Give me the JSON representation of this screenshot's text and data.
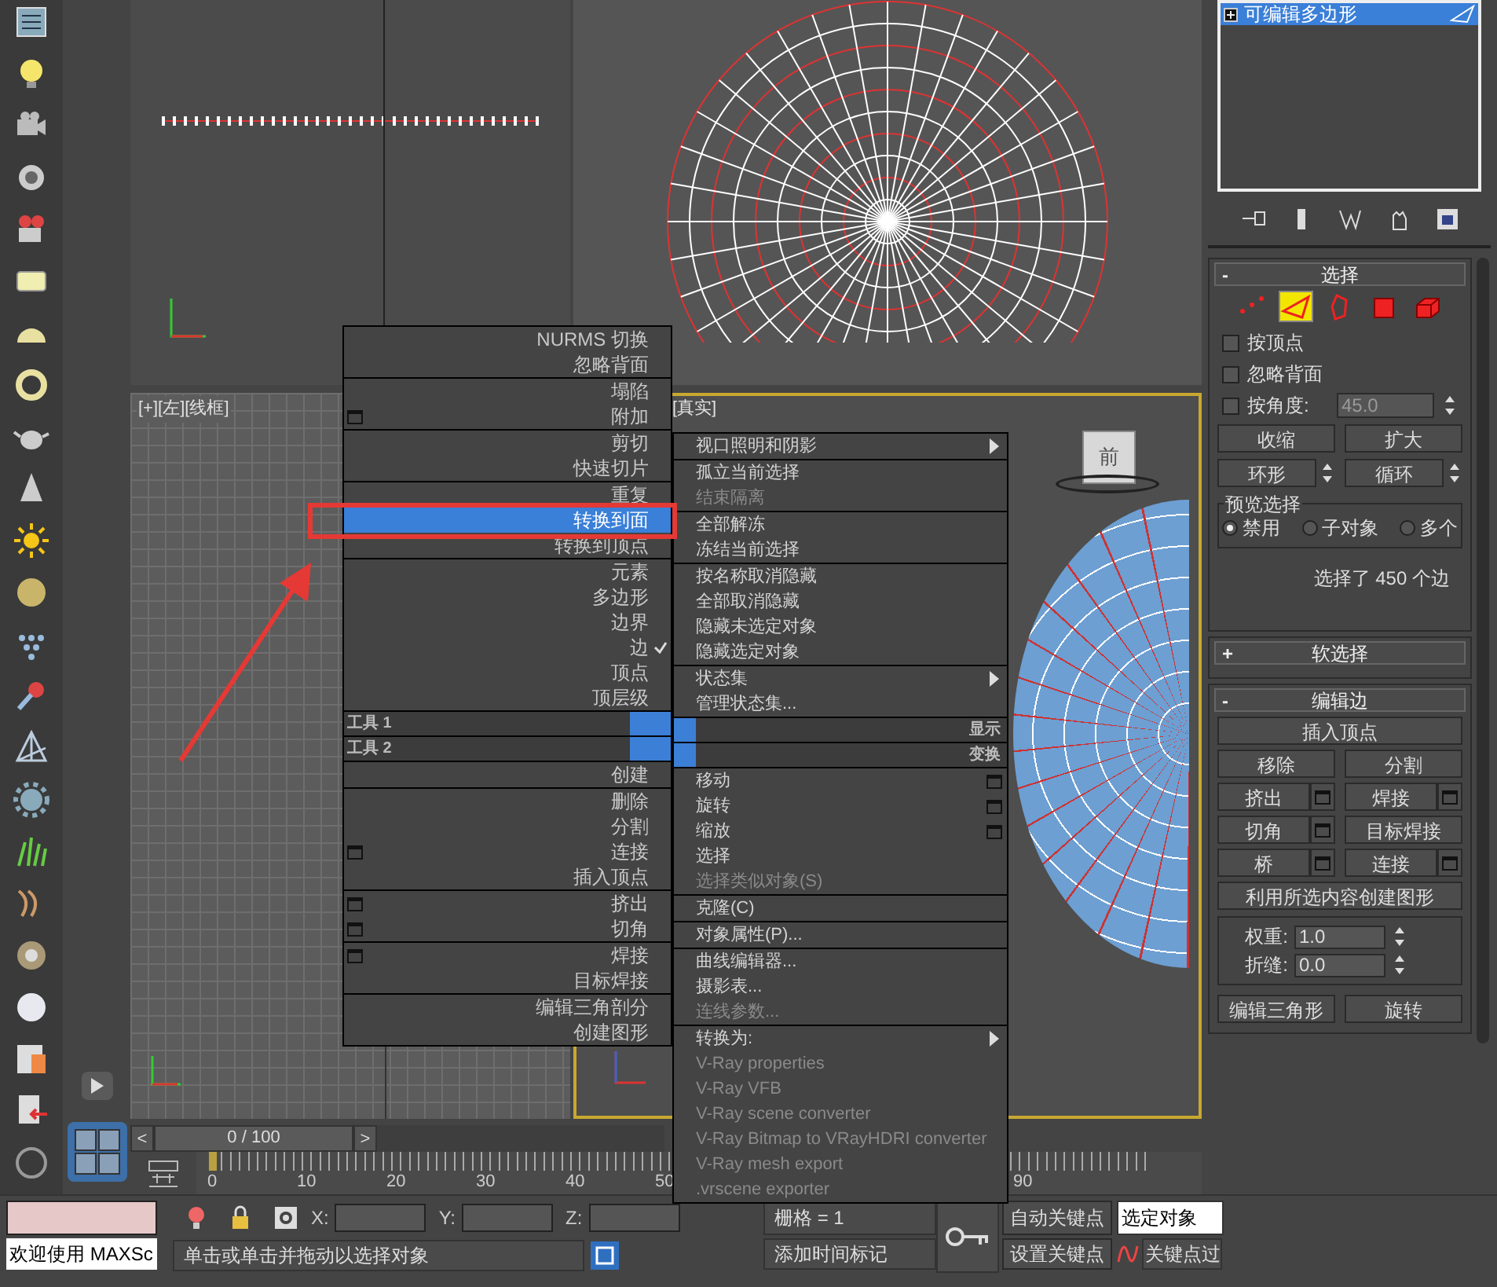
{
  "viewports": [
    {
      "label": "[+][左][线框]"
    },
    {
      "label": "[真实]"
    }
  ],
  "viewcube": {
    "label": "前"
  },
  "quad_menu_left": [
    {
      "kind": "group",
      "items": [
        {
          "label": "NURMS 切换",
          "selected": false,
          "checked": false,
          "options": false
        },
        {
          "label": "忽略背面",
          "selected": false,
          "checked": false,
          "options": false
        }
      ]
    },
    {
      "kind": "group",
      "items": [
        {
          "label": "塌陷",
          "selected": false,
          "checked": false,
          "options": false
        },
        {
          "label": "附加",
          "selected": false,
          "checked": false,
          "options": true
        }
      ]
    },
    {
      "kind": "group",
      "items": [
        {
          "label": "剪切",
          "selected": false,
          "checked": false,
          "options": false
        },
        {
          "label": "快速切片",
          "selected": false,
          "checked": false,
          "options": false
        }
      ]
    },
    {
      "kind": "group",
      "items": [
        {
          "label": "重复",
          "selected": false,
          "checked": false,
          "options": false
        },
        {
          "label": "转换到面",
          "selected": true,
          "checked": false,
          "options": false
        },
        {
          "label": "转换到顶点",
          "selected": false,
          "checked": false,
          "options": false
        }
      ]
    },
    {
      "kind": "group",
      "items": [
        {
          "label": "元素",
          "selected": false,
          "checked": false,
          "options": false
        },
        {
          "label": "多边形",
          "selected": false,
          "checked": false,
          "options": false
        },
        {
          "label": "边界",
          "selected": false,
          "checked": false,
          "options": false
        },
        {
          "label": "边",
          "selected": false,
          "checked": true,
          "options": false
        },
        {
          "label": "顶点",
          "selected": false,
          "checked": false,
          "options": false
        },
        {
          "label": "顶层级",
          "selected": false,
          "checked": false,
          "options": false
        }
      ]
    },
    {
      "kind": "header",
      "label": "工具 1"
    },
    {
      "kind": "header",
      "label": "工具 2"
    },
    {
      "kind": "group",
      "items": [
        {
          "label": "创建",
          "selected": false,
          "checked": false,
          "options": false
        }
      ]
    },
    {
      "kind": "group",
      "items": [
        {
          "label": "删除",
          "selected": false,
          "checked": false,
          "options": false
        },
        {
          "label": "分割",
          "selected": false,
          "checked": false,
          "options": false
        },
        {
          "label": "连接",
          "selected": false,
          "checked": false,
          "options": true
        },
        {
          "label": "插入顶点",
          "selected": false,
          "checked": false,
          "options": false
        }
      ]
    },
    {
      "kind": "group",
      "items": [
        {
          "label": "挤出",
          "selected": false,
          "checked": false,
          "options": true
        },
        {
          "label": "切角",
          "selected": false,
          "checked": false,
          "options": true
        }
      ]
    },
    {
      "kind": "group",
      "items": [
        {
          "label": "焊接",
          "selected": false,
          "checked": false,
          "options": true
        },
        {
          "label": "目标焊接",
          "selected": false,
          "checked": false,
          "options": false
        }
      ]
    },
    {
      "kind": "group",
      "items": [
        {
          "label": "编辑三角剖分",
          "selected": false,
          "checked": false,
          "options": false
        },
        {
          "label": "创建图形",
          "selected": false,
          "checked": false,
          "options": false
        }
      ]
    }
  ],
  "quad_menu_right": [
    {
      "kind": "group",
      "items": [
        {
          "label": "视口照明和阴影",
          "disabled": false,
          "submenu": true,
          "options": false
        }
      ]
    },
    {
      "kind": "group",
      "items": [
        {
          "label": "孤立当前选择",
          "disabled": false,
          "submenu": false,
          "options": false
        },
        {
          "label": "结束隔离",
          "disabled": true,
          "submenu": false,
          "options": false
        }
      ]
    },
    {
      "kind": "group",
      "items": [
        {
          "label": "全部解冻",
          "disabled": false,
          "submenu": false,
          "options": false
        },
        {
          "label": "冻结当前选择",
          "disabled": false,
          "submenu": false,
          "options": false
        }
      ]
    },
    {
      "kind": "group",
      "items": [
        {
          "label": "按名称取消隐藏",
          "disabled": false,
          "submenu": false,
          "options": false
        },
        {
          "label": "全部取消隐藏",
          "disabled": false,
          "submenu": false,
          "options": false
        },
        {
          "label": "隐藏未选定对象",
          "disabled": false,
          "submenu": false,
          "options": false
        },
        {
          "label": "隐藏选定对象",
          "disabled": false,
          "submenu": false,
          "options": false
        }
      ]
    },
    {
      "kind": "group",
      "items": [
        {
          "label": "状态集",
          "disabled": false,
          "submenu": true,
          "options": false
        },
        {
          "label": "管理状态集...",
          "disabled": false,
          "submenu": false,
          "options": false
        }
      ]
    },
    {
      "kind": "header",
      "label": "显示"
    },
    {
      "kind": "header",
      "label": "变换"
    },
    {
      "kind": "group",
      "items": [
        {
          "label": "移动",
          "disabled": false,
          "submenu": false,
          "options": true
        },
        {
          "label": "旋转",
          "disabled": false,
          "submenu": false,
          "options": true
        },
        {
          "label": "缩放",
          "disabled": false,
          "submenu": false,
          "options": true
        },
        {
          "label": "选择",
          "disabled": false,
          "submenu": false,
          "options": false
        },
        {
          "label": "选择类似对象(S)",
          "disabled": true,
          "submenu": false,
          "options": false
        }
      ]
    },
    {
      "kind": "group",
      "items": [
        {
          "label": "克隆(C)",
          "disabled": false,
          "submenu": false,
          "options": false
        }
      ]
    },
    {
      "kind": "group",
      "items": [
        {
          "label": "对象属性(P)...",
          "disabled": false,
          "submenu": false,
          "options": false
        }
      ]
    },
    {
      "kind": "group",
      "items": [
        {
          "label": "曲线编辑器...",
          "disabled": false,
          "submenu": false,
          "options": false
        },
        {
          "label": "摄影表...",
          "disabled": false,
          "submenu": false,
          "options": false
        },
        {
          "label": "连线参数...",
          "disabled": true,
          "submenu": false,
          "options": false
        }
      ]
    },
    {
      "kind": "group",
      "items": [
        {
          "label": "转换为:",
          "disabled": false,
          "submenu": true,
          "options": false
        },
        {
          "label": "V-Ray properties",
          "disabled": true,
          "submenu": false,
          "options": false
        },
        {
          "label": "V-Ray VFB",
          "disabled": true,
          "submenu": false,
          "options": false
        },
        {
          "label": "V-Ray scene converter",
          "disabled": true,
          "submenu": false,
          "options": false
        },
        {
          "label": "V-Ray Bitmap to VRayHDRI converter",
          "disabled": true,
          "submenu": false,
          "options": false
        },
        {
          "label": "V-Ray mesh export",
          "disabled": true,
          "submenu": false,
          "options": false
        },
        {
          "label": ".vrscene exporter",
          "disabled": true,
          "submenu": false,
          "options": false
        }
      ]
    }
  ],
  "command_panel": {
    "modifier_stack": [
      {
        "label": "可编辑多边形",
        "selected": true
      }
    ],
    "rollouts": [
      {
        "kind": "selection",
        "toggle": "-",
        "title": "选择",
        "subobjects": [
          {
            "selected": false
          },
          {
            "selected": true
          },
          {
            "selected": false
          },
          {
            "selected": false
          },
          {
            "selected": false
          }
        ],
        "checkboxes": [
          {
            "label": "按顶点",
            "checked": false
          },
          {
            "label": "忽略背面",
            "checked": false
          },
          {
            "label": "按角度:",
            "checked": false,
            "value": "45.0"
          }
        ],
        "buttons": [
          "收缩",
          "扩大"
        ],
        "spin_buttons": [
          "环形",
          "循环"
        ],
        "preview": {
          "title": "预览选择",
          "options": [
            {
              "label": "禁用",
              "selected": true
            },
            {
              "label": "子对象",
              "selected": false
            },
            {
              "label": "多个",
              "selected": false
            }
          ]
        },
        "status": "选择了 450 个边"
      },
      {
        "kind": "collapsed",
        "toggle": "+",
        "title": "软选择"
      },
      {
        "kind": "edit_edges",
        "toggle": "-",
        "title": "编辑边",
        "rows": [
          [
            {
              "label": "插入顶点",
              "options": false
            }
          ],
          [
            {
              "label": "移除",
              "options": false
            },
            {
              "label": "分割",
              "options": false
            }
          ],
          [
            {
              "label": "挤出",
              "options": true
            },
            {
              "label": "焊接",
              "options": true
            }
          ],
          [
            {
              "label": "切角",
              "options": true
            },
            {
              "label": "目标焊接",
              "options": false
            }
          ],
          [
            {
              "label": "桥",
              "options": true
            },
            {
              "label": "连接",
              "options": true
            }
          ],
          [
            {
              "label": "利用所选内容创建图形",
              "options": false
            }
          ]
        ],
        "fields": [
          {
            "label": "权重:",
            "value": "1.0"
          },
          {
            "label": "折缝:",
            "value": "0.0"
          }
        ],
        "bottom_buttons": [
          "编辑三角形",
          "旋转"
        ]
      }
    ]
  },
  "time_slider": {
    "prev": "<",
    "label": "0 / 100",
    "next": ">",
    "level": 0
  },
  "track_bar": {
    "ticks": [
      "0",
      "10",
      "20",
      "30",
      "40",
      "50",
      "90"
    ]
  },
  "status_bar": {
    "welcome": "欢迎使用 MAXSc",
    "prompt": "单击或单击并拖动以选择对象",
    "coords": [
      "X:",
      "Y:",
      "Z:"
    ],
    "grid": "栅格 = 1",
    "auto_key": "自动关键点",
    "set_key": "设置关键点",
    "key_filter_dropdown": "选定对象",
    "add_time_tag": "添加时间标记",
    "key_filters": "关键点过"
  }
}
